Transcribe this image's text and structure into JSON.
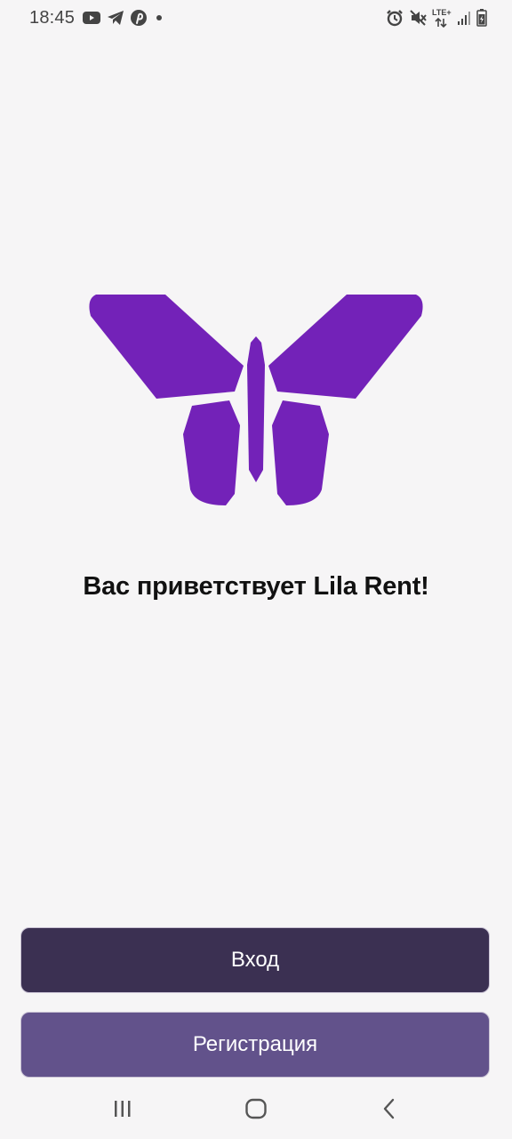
{
  "status_bar": {
    "time": "18:45",
    "network_type": "LTE+",
    "left_icons": [
      "youtube-icon",
      "telegram-icon",
      "pinterest-icon",
      "dot-icon"
    ],
    "right_icons": [
      "alarm-icon",
      "mute-icon",
      "lte-icon",
      "signal-icon",
      "battery-icon"
    ]
  },
  "main": {
    "welcome_text": "Вас приветствует Lila Rent!"
  },
  "actions": {
    "login_label": "Вход",
    "register_label": "Регистрация"
  },
  "nav_bar": {
    "items": [
      "recent-apps-icon",
      "home-icon",
      "back-icon"
    ]
  },
  "colors": {
    "background": "#f6f5f6",
    "logo": "#7322b8",
    "login_button": "#3b3052",
    "register_button": "#62528b",
    "button_text": "#ffffff"
  }
}
